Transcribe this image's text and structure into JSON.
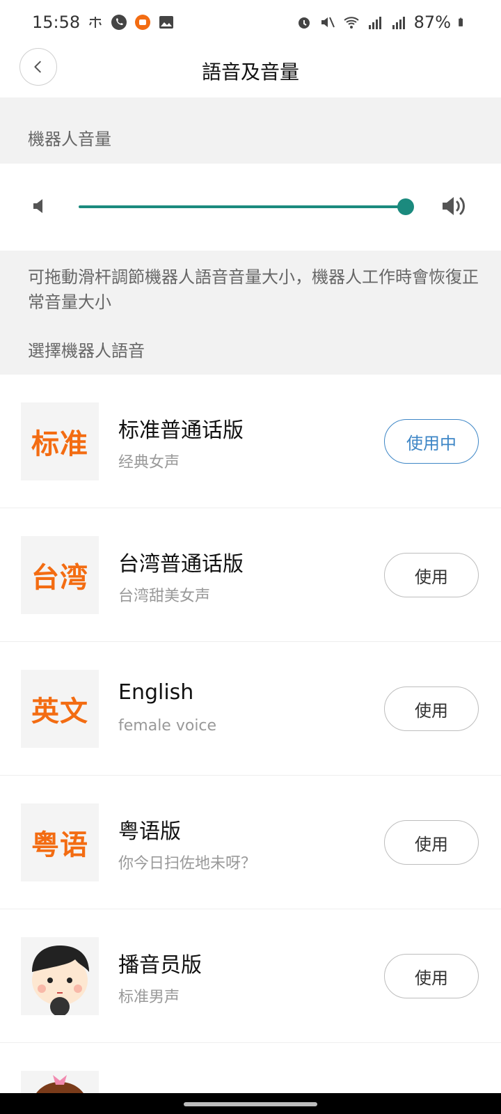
{
  "status": {
    "time": "15:58",
    "battery": "87%",
    "left_icons": [
      "network-icon",
      "phone-call-icon",
      "mi-app-icon",
      "gallery-icon"
    ],
    "right_icons": [
      "alarm-icon",
      "mute-icon",
      "wifi-icon",
      "signal-icon",
      "signal-icon",
      "battery-icon"
    ]
  },
  "header": {
    "title": "語音及音量"
  },
  "volume_section": {
    "title": "機器人音量",
    "level": 1.0,
    "description": "可拖動滑杆調節機器人語音音量大小，機器人工作時會恢復正常音量大小"
  },
  "voice_section": {
    "title": "選擇機器人語音",
    "items": [
      {
        "thumb": "标准",
        "title": "标准普通话版",
        "subtitle": "经典女声",
        "button": "使用中",
        "active": true
      },
      {
        "thumb": "台湾",
        "title": "台湾普通话版",
        "subtitle": "台湾甜美女声",
        "button": "使用",
        "active": false
      },
      {
        "thumb": "英文",
        "title": "English",
        "subtitle": "female voice",
        "button": "使用",
        "active": false
      },
      {
        "thumb": "粤语",
        "title": "粤语版",
        "subtitle": "你今日扫佐地未呀？",
        "button": "使用",
        "active": false
      },
      {
        "thumb": "",
        "title": "播音员版",
        "subtitle": "标准男声",
        "button": "使用",
        "active": false
      }
    ]
  },
  "colors": {
    "accent": "#1b8a7e",
    "active_button": "#3d86c6",
    "thumb_text": "#f36c12"
  }
}
